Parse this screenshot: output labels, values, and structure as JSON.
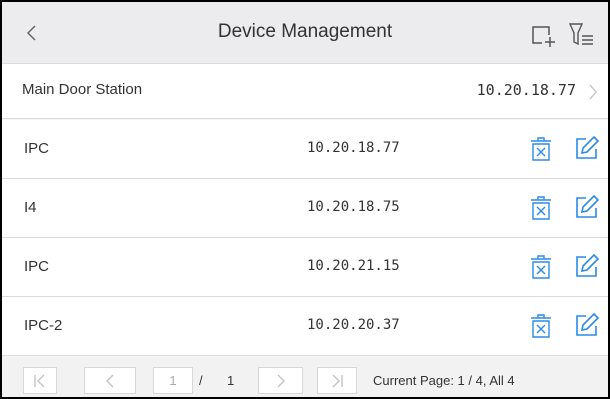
{
  "header": {
    "back_icon": "chevron-left-icon",
    "title": "Device Management",
    "add_icon": "add-device-icon",
    "filter_icon": "filter-list-icon"
  },
  "main_device": {
    "name": "Main Door Station",
    "ip": "10.20.18.77",
    "chevron_icon": "chevron-right-icon"
  },
  "devices": [
    {
      "name": "IPC",
      "ip": "10.20.18.77"
    },
    {
      "name": "I4",
      "ip": "10.20.18.75"
    },
    {
      "name": "IPC",
      "ip": "10.20.21.15"
    },
    {
      "name": "IPC-2",
      "ip": "10.20.20.37"
    }
  ],
  "pagination": {
    "current_input": "1",
    "separator": "/",
    "total_pages": "1",
    "status": "Current Page: 1 / 4, All 4",
    "first_icon": "first-page-icon",
    "prev_icon": "prev-page-icon",
    "next_icon": "next-page-icon",
    "last_icon": "last-page-icon"
  },
  "colors": {
    "accent": "#2b8ae8",
    "header_bg": "#ececee",
    "divider": "#dcdcdc"
  }
}
